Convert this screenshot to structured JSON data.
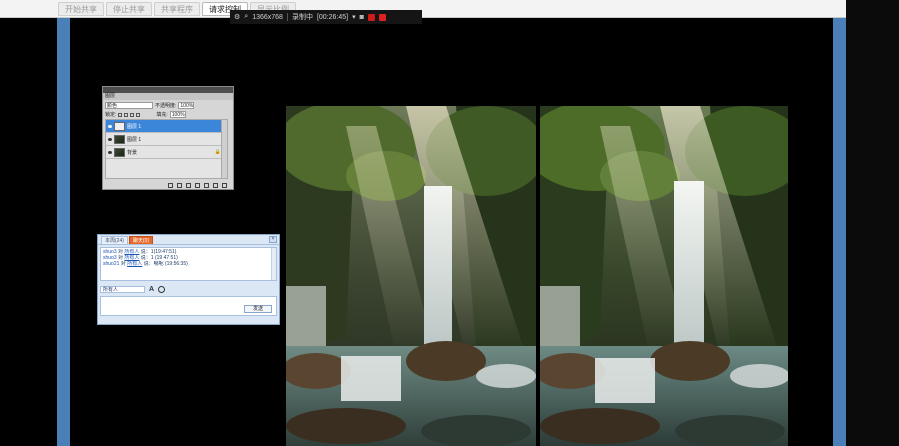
{
  "top_tabs": [
    {
      "label": "开始共享",
      "active": false
    },
    {
      "label": "停止共享",
      "active": false
    },
    {
      "label": "共享程序",
      "active": false
    },
    {
      "label": "请求控制",
      "active": true
    },
    {
      "label": "显示比例",
      "active": false
    }
  ],
  "recorder": {
    "resolution": "1366x768",
    "status_label": "录制中",
    "elapsed": "[00:26:45]"
  },
  "layers_panel": {
    "header": "图层",
    "blend_mode": "颜色",
    "opacity_label": "不透明度:",
    "opacity_value": "100%",
    "lock_label": "锁定:",
    "fill_label": "填充:",
    "fill_value": "100%",
    "layers": [
      {
        "name": "图层 1",
        "selected": true
      },
      {
        "name": "图层 1",
        "selected": false
      },
      {
        "name": "背景",
        "selected": false
      }
    ]
  },
  "chat": {
    "tabs": [
      {
        "label": "本周(24)",
        "active": false
      },
      {
        "label": "聊天(0)",
        "active": true
      }
    ],
    "messages": [
      {
        "user": "shuo3",
        "verb": " 对 ",
        "target": "所有人",
        "text": " 说：1(19:47:51)"
      },
      {
        "user": "shuo3",
        "verb": " 对 ",
        "target": "所有人",
        "text": " 说：1 (19 47 51)"
      },
      {
        "user": "shuo21",
        "verb": " 对 ",
        "target": "所有人",
        "text": " 说：哪呢 (19:56:35)"
      }
    ],
    "recipient": "所有人",
    "send_label": "发送"
  },
  "colors": {
    "accent_blue": "#4a7fb7",
    "layer_selected": "#3b86d8",
    "chat_tab_active": "#e86a2a"
  }
}
